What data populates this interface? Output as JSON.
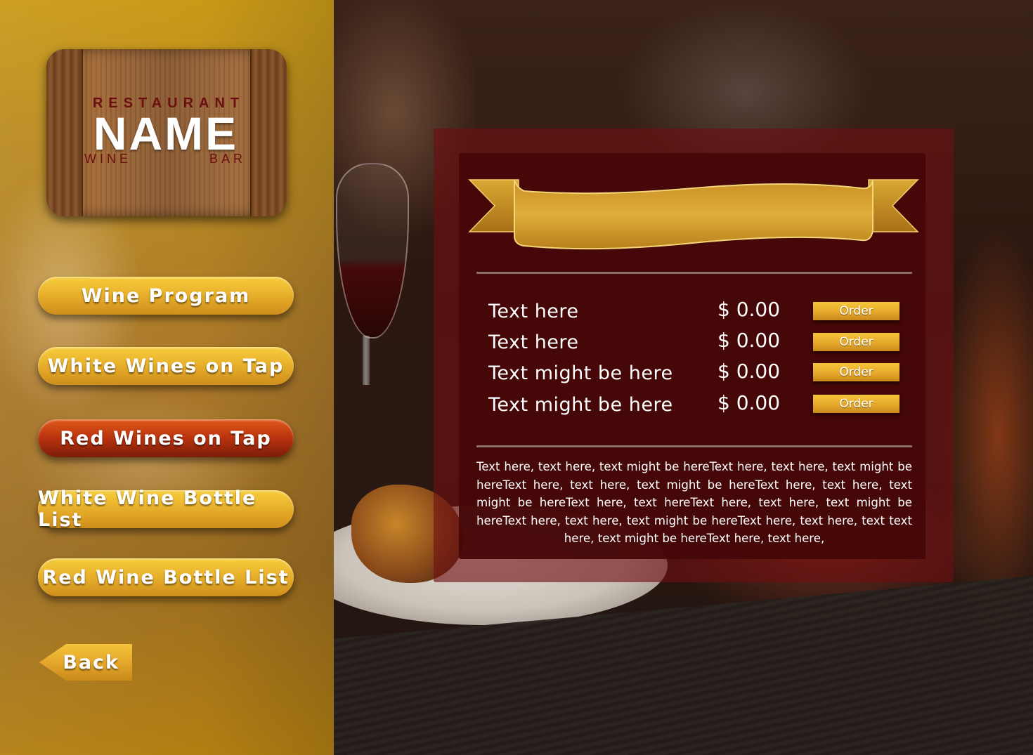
{
  "logo": {
    "top_text": "RESTAURANT",
    "name": "NAME",
    "bottom_left": "WINE",
    "bottom_right": "BAR"
  },
  "nav": {
    "items": [
      {
        "label": "Wine Program",
        "active": false
      },
      {
        "label": "White Wines on Tap",
        "active": false
      },
      {
        "label": "Red Wines on Tap",
        "active": true
      },
      {
        "label": "White Wine Bottle List",
        "active": false
      },
      {
        "label": "Red Wine Bottle List",
        "active": false
      }
    ],
    "back_label": "Back"
  },
  "menu": {
    "items": [
      {
        "name": "Text here",
        "price": "$ 0.00",
        "order_label": "Order"
      },
      {
        "name": "Text here",
        "price": "$ 0.00",
        "order_label": "Order"
      },
      {
        "name": "Text might be here",
        "price": "$ 0.00",
        "order_label": "Order"
      },
      {
        "name": "Text might be here",
        "price": "$ 0.00",
        "order_label": "Order"
      }
    ],
    "description": "Text here, text here, text might be hereText here, text here, text might be hereText here, text here, text might be hereText here, text here, text might be hereText here, text hereText here, text here, text might be hereText here, text here, text might be hereText here, text here, text text here, text might be hereText here, text here,"
  },
  "colors": {
    "gold": "#e9b12c",
    "active_red": "#b8320e",
    "card_maroon": "#440606"
  },
  "icons": {
    "banner": "ribbon-banner-icon",
    "back": "back-arrow-icon"
  }
}
